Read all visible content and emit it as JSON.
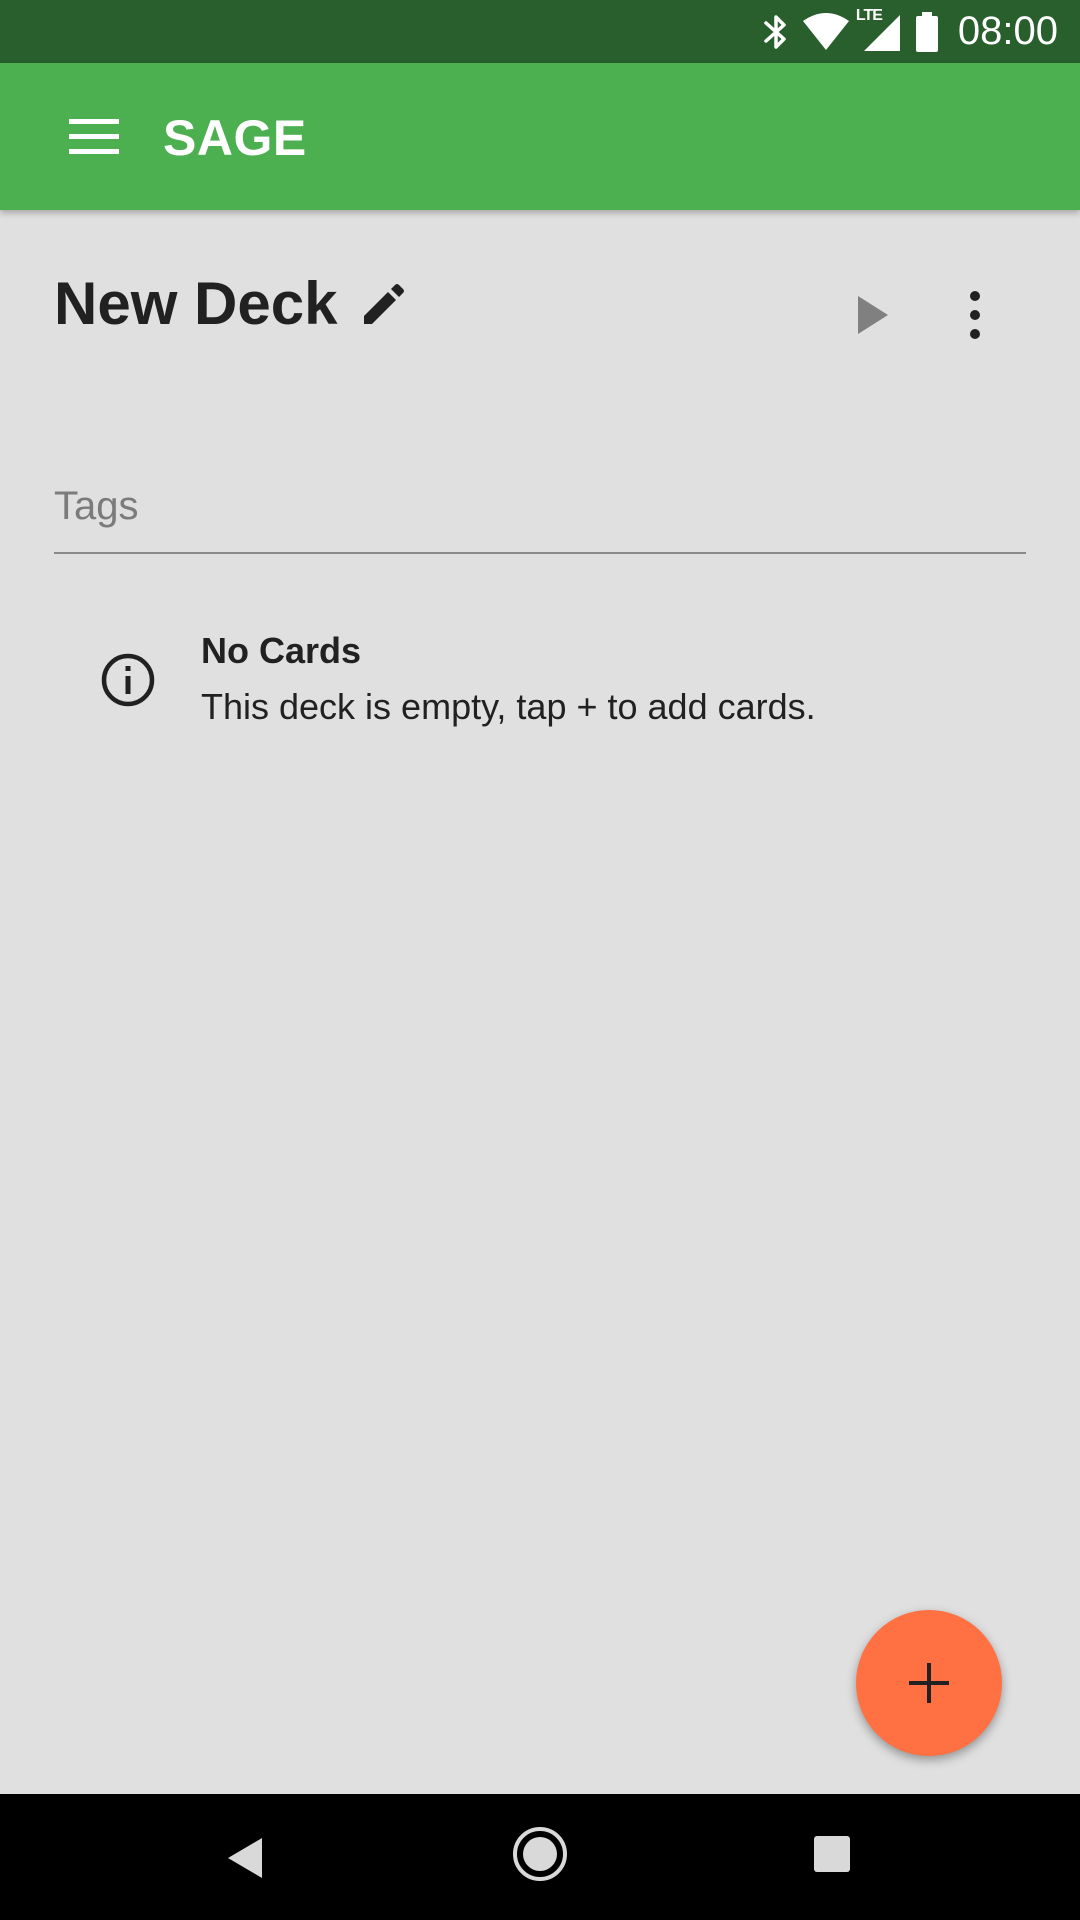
{
  "status_bar": {
    "time": "08:00",
    "network_label": "LTE",
    "icons": [
      "bluetooth-icon",
      "wifi-icon",
      "lte-signal-icon",
      "battery-icon"
    ]
  },
  "app_bar": {
    "title": "SAGE",
    "menu_icon": "hamburger-menu-icon",
    "background": "#4caf50"
  },
  "deck": {
    "title": "New Deck",
    "edit_icon": "pencil-icon",
    "play_icon": "play-icon",
    "more_icon": "more-vert-icon"
  },
  "tags": {
    "placeholder": "Tags",
    "value": ""
  },
  "empty_state": {
    "icon": "info-icon",
    "title": "No Cards",
    "message": "This deck is empty, tap + to add cards."
  },
  "fab": {
    "icon": "plus-icon",
    "color": "#ff7043"
  },
  "nav_bar": {
    "icons": [
      "back-icon",
      "home-icon",
      "recents-icon"
    ]
  }
}
